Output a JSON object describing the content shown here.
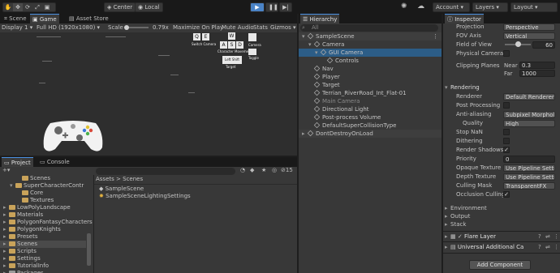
{
  "toolbar": {
    "center_label": "Center",
    "local_label": "Local",
    "account_label": "Account",
    "layers_label": "Layers",
    "layout_label": "Layout"
  },
  "scene_tabs": {
    "scene": "Scene",
    "game": "Game",
    "asset_store": "Asset Store"
  },
  "game_toolbar": {
    "display": "Display 1",
    "resolution": "Full HD (1920x1080)",
    "scale_label": "Scale",
    "scale_value": "0.79x",
    "maximize": "Maximize On Play",
    "mute": "Mute Audio",
    "stats": "Stats",
    "gizmos": "Gizmos"
  },
  "game_view": {
    "hud_left": "Switch Camera",
    "hud_mid": "Character Movement",
    "hud_right": "Camera",
    "hud_right2": "Toggle",
    "hud_target": "Target",
    "hud_leftshift": "Left Shift"
  },
  "hierarchy": {
    "tab": "Hierarchy",
    "search": "All",
    "items": [
      {
        "label": "SampleScene",
        "depth": 0
      },
      {
        "label": "Camera",
        "depth": 1
      },
      {
        "label": "GUI Camera",
        "depth": 2
      },
      {
        "label": "Controls",
        "depth": 3
      },
      {
        "label": "Nav",
        "depth": 1
      },
      {
        "label": "Player",
        "depth": 1
      },
      {
        "label": "Target",
        "depth": 1
      },
      {
        "label": "Terrian_RiverRoad_Int_Flat-01",
        "depth": 1
      },
      {
        "label": "Main Camera",
        "depth": 1
      },
      {
        "label": "Directional Light",
        "depth": 1
      },
      {
        "label": "Post-process Volume",
        "depth": 1
      },
      {
        "label": "DefaultSuperCollisionType",
        "depth": 1
      },
      {
        "label": "DontDestroyOnLoad",
        "depth": 0
      }
    ]
  },
  "project": {
    "tab_project": "Project",
    "tab_console": "Console",
    "breadcrumb_root": "Assets",
    "breadcrumb_sep": ">",
    "breadcrumb_leaf": "Scenes",
    "count": "15",
    "tree": [
      {
        "label": "Scenes",
        "depth": 2
      },
      {
        "label": "SuperCharacterContr",
        "depth": 1
      },
      {
        "label": "Core",
        "depth": 2
      },
      {
        "label": "Textures",
        "depth": 2
      },
      {
        "label": "LowPolyLandscape",
        "depth": 0
      },
      {
        "label": "Materials",
        "depth": 0
      },
      {
        "label": "PolygonFantasyCharacters",
        "depth": 0
      },
      {
        "label": "PolygonKnights",
        "depth": 0
      },
      {
        "label": "Presets",
        "depth": 0
      },
      {
        "label": "Scenes",
        "depth": 0
      },
      {
        "label": "Scripts",
        "depth": 0
      },
      {
        "label": "Settings",
        "depth": 0
      },
      {
        "label": "TutorialInfo",
        "depth": 0
      },
      {
        "label": "Packages",
        "depth": -1
      }
    ],
    "files": [
      "SampleScene",
      "SampleSceneLightingSettings"
    ]
  },
  "inspector": {
    "tab": "Inspector",
    "projection_label": "Projection",
    "projection_value": "Perspective",
    "fov_axis_label": "FOV Axis",
    "fov_axis_value": "Vertical",
    "fov_label": "Field of View",
    "fov_value": "60",
    "physical_label": "Physical Camera",
    "clipping_label": "Clipping Planes",
    "near_label": "Near",
    "near_value": "0.3",
    "far_label": "Far",
    "far_value": "1000",
    "rendering_header": "Rendering",
    "renderer_label": "Renderer",
    "renderer_value": "Default Renderer",
    "post_label": "Post Processing",
    "aa_label": "Anti-aliasing",
    "aa_value": "Subpixel Morphol",
    "quality_label": "Quality",
    "quality_value": "High",
    "stopnan_label": "Stop NaN",
    "dither_label": "Dithering",
    "shadows_label": "Render Shadows",
    "priority_label": "Priority",
    "priority_value": "0",
    "opaque_label": "Opaque Texture",
    "opaque_value": "Use Pipeline Setti",
    "depth_label": "Depth Texture",
    "depth_value": "Use Pipeline Setti",
    "culling_label": "Culling Mask",
    "culling_value": "TransparentFX",
    "occlusion_label": "Occlusion Culling",
    "environment_header": "Environment",
    "output_header": "Output",
    "stack_header": "Stack",
    "flare_label": "Flare Layer",
    "urp_label": "Universal Additional Ca",
    "add_component": "Add Component"
  }
}
